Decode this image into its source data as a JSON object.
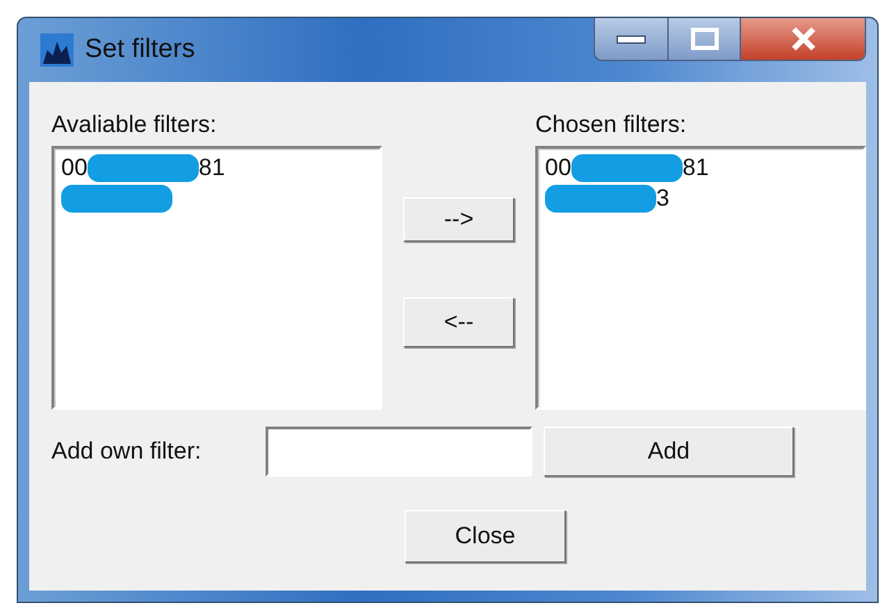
{
  "window": {
    "title": "Set filters"
  },
  "available": {
    "label": "Avaliable filters:",
    "items": [
      {
        "parts": [
          {
            "kind": "text",
            "text": "00"
          },
          {
            "kind": "redaction"
          },
          {
            "kind": "text",
            "text": "81"
          }
        ]
      },
      {
        "parts": [
          {
            "kind": "redaction"
          }
        ]
      }
    ]
  },
  "move_buttons": [
    "-->",
    "<--"
  ],
  "chosen": {
    "label": "Chosen filters:",
    "items": [
      {
        "parts": [
          {
            "kind": "text",
            "text": "00"
          },
          {
            "kind": "redaction"
          },
          {
            "kind": "text",
            "text": "81"
          }
        ]
      },
      {
        "parts": [
          {
            "kind": "redaction"
          },
          {
            "kind": "text",
            "text": "3"
          }
        ]
      }
    ]
  },
  "own_filter": {
    "label": "Add own filter:",
    "button": "Add"
  },
  "close_button": "Close"
}
